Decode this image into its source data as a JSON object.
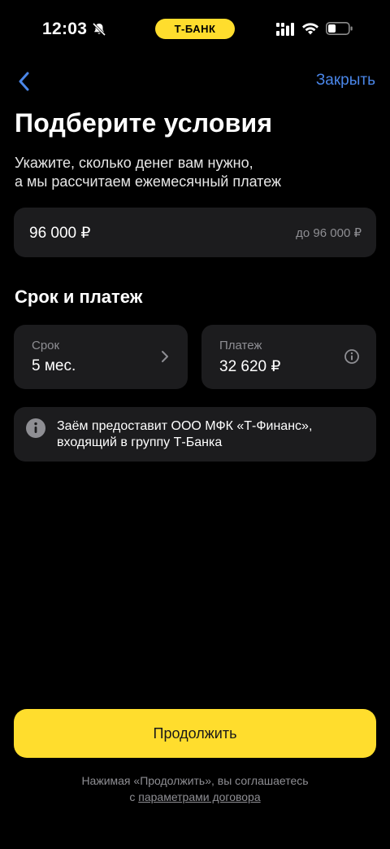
{
  "status_bar": {
    "time": "12:03",
    "brand": "Т-БАНК",
    "icons": [
      "bell-slash-icon",
      "signal-icon",
      "wifi-icon",
      "battery-icon"
    ]
  },
  "nav": {
    "back_icon": "chevron-left-icon",
    "close_label": "Закрыть"
  },
  "header": {
    "title": "Подберите условия",
    "subtitle_line1": "Укажите, сколько денег вам нужно,",
    "subtitle_line2": "а мы рассчитаем ежемесячный платеж"
  },
  "amount": {
    "value": "96 000 ₽",
    "limit": "до 96 000 ₽"
  },
  "section": {
    "title": "Срок и платеж"
  },
  "term": {
    "label": "Срок",
    "value": "5 мес.",
    "icon": "chevron-right-icon"
  },
  "payment": {
    "label": "Платеж",
    "value": "32 620 ₽",
    "icon": "info-circle-icon"
  },
  "notice": {
    "icon": "info-icon",
    "line1": "Заём предоставит ООО МФК «Т-Финанс»,",
    "line2": "входящий в группу Т-Банка"
  },
  "footer": {
    "button_label": "Продолжить",
    "legal_line1": "Нажимая «Продолжить», вы соглашаетесь",
    "legal_prefix": "с ",
    "legal_link": "параметрами договора"
  },
  "colors": {
    "background": "#000000",
    "card": "#1c1c1e",
    "accent_yellow": "#ffdd2d",
    "link_blue": "#4a86e8",
    "secondary_text": "#8e8e93"
  }
}
